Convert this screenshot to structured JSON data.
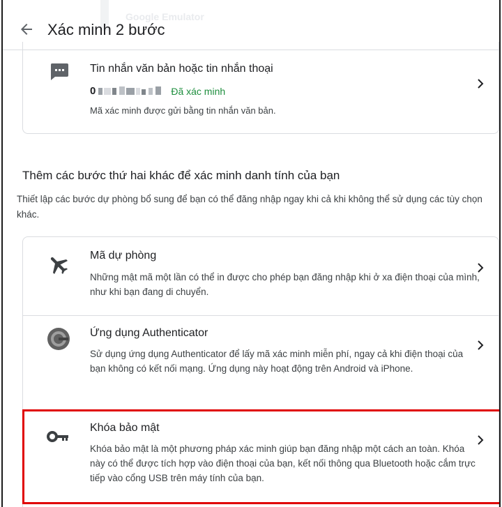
{
  "header": {
    "title": "Xác minh 2 bước",
    "ghost_text": "Google Emulator"
  },
  "sms_card": {
    "title": "Tin nhắn văn bản hoặc tin nhắn thoại",
    "phone_prefix": "0",
    "verified_label": "Đã xác minh",
    "description": "Mã xác minh được gửi bằng tin nhắn văn bản.",
    "icon": "message-icon"
  },
  "more_steps": {
    "heading": "Thêm các bước thứ hai khác để xác minh danh tính của bạn",
    "description": "Thiết lập các bước dự phòng bổ sung để bạn có thể đăng nhập ngay khi cả khi không thể sử dụng các tùy chọn khác."
  },
  "options": [
    {
      "title": "Mã dự phòng",
      "description": "Những mật mã một lần có thể in được cho phép bạn đăng nhập khi ở xa điện thoại của mình, như khi bạn đang di chuyển.",
      "icon": "airplane-icon"
    },
    {
      "title": "Ứng dụng Authenticator",
      "description": "Sử dụng ứng dụng Authenticator để lấy mã xác minh miễn phí, ngay cả khi điện thoại của bạn không có kết nối mạng. Ứng dụng này hoạt động trên Android và iPhone.",
      "icon": "authenticator-icon"
    },
    {
      "title": "Khóa bảo mật",
      "description": "Khóa bảo mật là một phương pháp xác minh giúp bạn đăng nhập một cách an toàn. Khóa này có thể được tích hợp vào điện thoại của bạn, kết nối thông qua Bluetooth hoặc cắm trực tiếp vào cổng USB trên máy tính của bạn.",
      "icon": "key-icon"
    }
  ],
  "colors": {
    "verified": "#1e8e3e",
    "highlight": "#e00000",
    "icon": "#5f6368"
  }
}
